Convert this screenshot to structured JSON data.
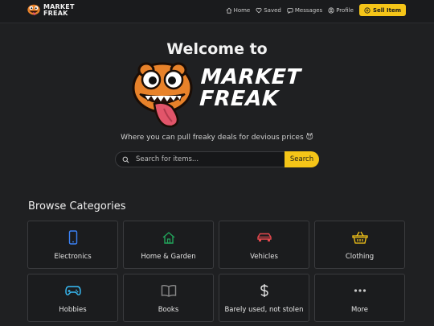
{
  "header": {
    "logo_line1": "MARKET",
    "logo_line2": "FREAK",
    "nav": [
      {
        "label": "Home",
        "icon": "home-icon"
      },
      {
        "label": "Saved",
        "icon": "heart-icon"
      },
      {
        "label": "Messages",
        "icon": "message-icon"
      },
      {
        "label": "Profile",
        "icon": "user-icon"
      }
    ],
    "sell_label": "Sell Item"
  },
  "hero": {
    "welcome": "Welcome to",
    "brand_line1": "MARKET",
    "brand_line2": "FREAK",
    "tagline": "Where you can pull freaky deals for devious prices 😈"
  },
  "search": {
    "placeholder": "Search for items...",
    "button": "Search"
  },
  "categories": {
    "title": "Browse Categories",
    "items": [
      {
        "label": "Electronics",
        "icon": "phone-icon",
        "color": "#3b82f6"
      },
      {
        "label": "Home & Garden",
        "icon": "house-icon",
        "color": "#22a35a"
      },
      {
        "label": "Vehicles",
        "icon": "car-icon",
        "color": "#e5484d"
      },
      {
        "label": "Clothing",
        "icon": "basket-icon",
        "color": "#f5c518"
      },
      {
        "label": "Hobbies",
        "icon": "gamepad-icon",
        "color": "#38bdf8"
      },
      {
        "label": "Books",
        "icon": "book-icon",
        "color": "#8a8a8a"
      },
      {
        "label": "Barely used, not stolen",
        "icon": "dollar-icon",
        "color": "#e8e8e8"
      },
      {
        "label": "More",
        "icon": "more-icon",
        "color": "#c9c9c9"
      }
    ]
  },
  "colors": {
    "accent": "#f5c518",
    "background": "#1f2022",
    "mascot": "#e8822a"
  }
}
